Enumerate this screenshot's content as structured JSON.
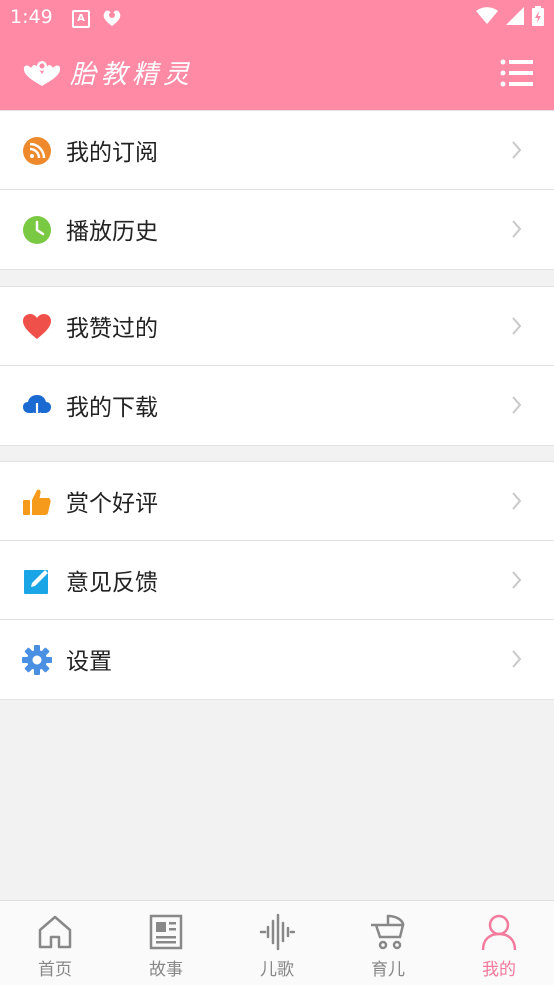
{
  "status_bar": {
    "time": "1:49"
  },
  "header": {
    "title": "胎教精灵"
  },
  "groups": [
    {
      "items": [
        {
          "label": "我的订阅",
          "icon": "rss-icon"
        },
        {
          "label": "播放历史",
          "icon": "clock-icon"
        }
      ]
    },
    {
      "items": [
        {
          "label": "我赞过的",
          "icon": "heart-icon"
        },
        {
          "label": "我的下载",
          "icon": "cloud-download-icon"
        }
      ]
    },
    {
      "items": [
        {
          "label": "赏个好评",
          "icon": "thumbs-up-icon"
        },
        {
          "label": "意见反馈",
          "icon": "edit-icon"
        },
        {
          "label": "设置",
          "icon": "gear-icon"
        }
      ]
    }
  ],
  "bottom_nav": {
    "tabs": [
      {
        "label": "首页",
        "icon": "home-icon"
      },
      {
        "label": "故事",
        "icon": "newspaper-icon"
      },
      {
        "label": "儿歌",
        "icon": "soundwave-icon"
      },
      {
        "label": "育儿",
        "icon": "stroller-icon"
      },
      {
        "label": "我的",
        "icon": "person-icon",
        "active": true
      }
    ]
  },
  "colors": {
    "header": "#fe8aa5",
    "active_tab": "#f27a9c"
  }
}
